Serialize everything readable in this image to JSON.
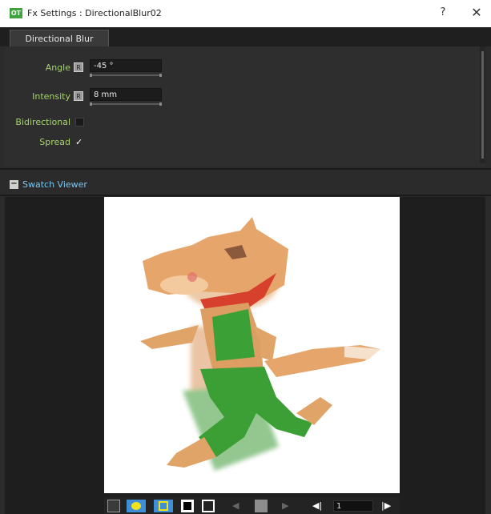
{
  "window": {
    "app_icon_text": "OT",
    "title": "Fx Settings : DirectionalBlur02",
    "help_label": "?",
    "close_label": "✕"
  },
  "tabs": [
    {
      "label": "Directional Blur",
      "active": true
    }
  ],
  "settings": {
    "angle": {
      "label": "Angle",
      "value": "-45 °"
    },
    "intensity": {
      "label": "Intensity",
      "value": "8 mm"
    },
    "bidirectional": {
      "label": "Bidirectional",
      "checked": false
    },
    "spread": {
      "label": "Spread",
      "checked": true,
      "mark": "✓"
    }
  },
  "swatch_viewer": {
    "collapse_label": "−",
    "title": "Swatch Viewer"
  },
  "toolbar": {
    "buttons": [
      "camera-icon",
      "preview-eye-icon",
      "yellow-frame-icon",
      "black-bg-icon",
      "checker-bg-icon",
      "prev-icon",
      "reference-icon",
      "next-icon",
      "first-frame-icon",
      "last-frame-icon"
    ],
    "frame_value": "1"
  },
  "colors": {
    "label_green": "#a4d36b",
    "link_blue": "#7bc6f2",
    "panel_bg": "#2e2e2e",
    "accent_yellow": "#f2e21c",
    "accent_blue": "#3f8fd8"
  }
}
